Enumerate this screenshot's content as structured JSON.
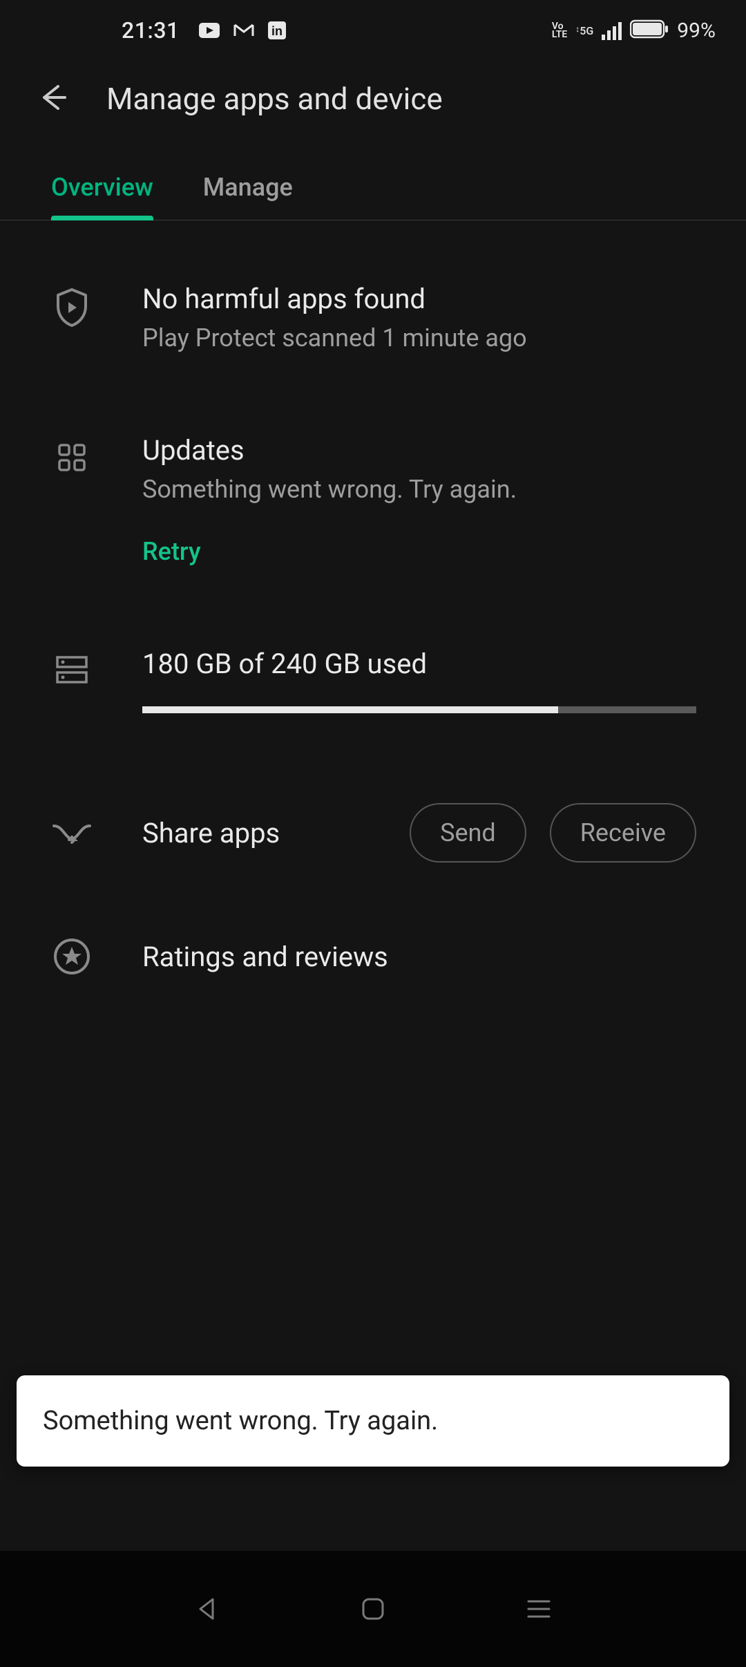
{
  "status": {
    "time": "21:31",
    "volte": "Vo\nLTE",
    "network": "5G",
    "battery_pct": "99%"
  },
  "header": {
    "title": "Manage apps and device"
  },
  "tabs": {
    "overview": "Overview",
    "manage": "Manage"
  },
  "protect": {
    "title": "No harmful apps found",
    "subtitle": "Play Protect scanned 1 minute ago"
  },
  "updates": {
    "title": "Updates",
    "subtitle": "Something went wrong. Try again.",
    "retry": "Retry"
  },
  "storage": {
    "label": "180 GB of 240 GB used",
    "used_pct": 75
  },
  "share": {
    "title": "Share apps",
    "send": "Send",
    "receive": "Receive"
  },
  "ratings": {
    "title": "Ratings and reviews"
  },
  "snackbar": {
    "text": "Something went wrong. Try again."
  }
}
